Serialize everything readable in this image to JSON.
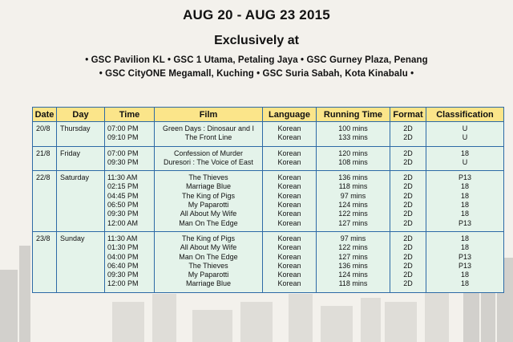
{
  "header": {
    "dates": "AUG 20 - AUG 23 2015",
    "exclusive": "Exclusively at",
    "venues_line1": "• GSC Pavilion KL • GSC 1 Utama, Petaling Jaya • GSC Gurney Plaza, Penang",
    "venues_line2": "• GSC CityONE Megamall, Kuching • GSC Suria Sabah, Kota Kinabalu •"
  },
  "table": {
    "columns": [
      "Date",
      "Day",
      "Time",
      "Film",
      "Language",
      "Running Time",
      "Format",
      "Classification"
    ],
    "groups": [
      {
        "date": "20/8",
        "day": "Thursday",
        "rows": [
          [
            "07:00 PM",
            "Green Days : Dinosaur and I",
            "Korean",
            "100 mins",
            "2D",
            "U"
          ],
          [
            "09:10 PM",
            "The Front Line",
            "Korean",
            "133 mins",
            "2D",
            "U"
          ]
        ]
      },
      {
        "date": "21/8",
        "day": "Friday",
        "rows": [
          [
            "07:00 PM",
            "Confession of Murder",
            "Korean",
            "120 mins",
            "2D",
            "18"
          ],
          [
            "09:30 PM",
            "Duresori : The Voice of East",
            "Korean",
            "108 mins",
            "2D",
            "U"
          ]
        ]
      },
      {
        "date": "22/8",
        "day": "Saturday",
        "rows": [
          [
            "11:30 AM",
            "The Thieves",
            "Korean",
            "136 mins",
            "2D",
            "P13"
          ],
          [
            "02:15 PM",
            "Marriage Blue",
            "Korean",
            "118 mins",
            "2D",
            "18"
          ],
          [
            "04:45 PM",
            "The King of Pigs",
            "Korean",
            "97 mins",
            "2D",
            "18"
          ],
          [
            "06:50 PM",
            "My Paparotti",
            "Korean",
            "124 mins",
            "2D",
            "18"
          ],
          [
            "09:30 PM",
            "All About My Wife",
            "Korean",
            "122 mins",
            "2D",
            "18"
          ],
          [
            "12:00 AM",
            "Man On The Edge",
            "Korean",
            "127 mins",
            "2D",
            "P13"
          ]
        ]
      },
      {
        "date": "23/8",
        "day": "Sunday",
        "rows": [
          [
            "11:30 AM",
            "The King of Pigs",
            "Korean",
            "97 mins",
            "2D",
            "18"
          ],
          [
            "01:30 PM",
            "All About My Wife",
            "Korean",
            "122 mins",
            "2D",
            "18"
          ],
          [
            "04:00 PM",
            "Man On The Edge",
            "Korean",
            "127 mins",
            "2D",
            "P13"
          ],
          [
            "06:40 PM",
            "The Thieves",
            "Korean",
            "136 mins",
            "2D",
            "P13"
          ],
          [
            "09:30 PM",
            "My Paparotti",
            "Korean",
            "124 mins",
            "2D",
            "18"
          ],
          [
            "12:00 PM",
            "Marriage Blue",
            "Korean",
            "118 mins",
            "2D",
            "18"
          ]
        ]
      }
    ]
  },
  "colors": {
    "header_fill": "#fbe58a",
    "row_fill": "#e4f3ea",
    "border": "#2d6aa6",
    "background": "#f3f1ec"
  }
}
